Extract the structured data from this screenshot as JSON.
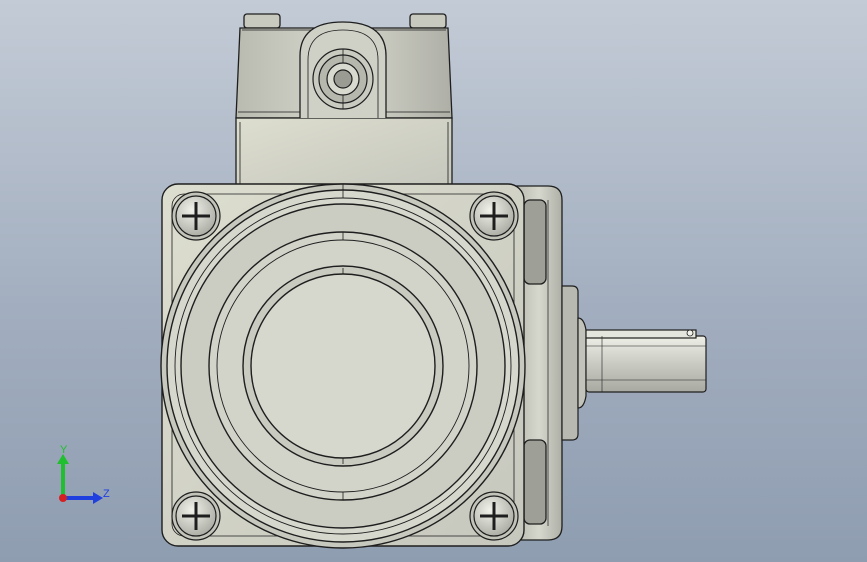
{
  "viewport": {
    "background_top": "#c3cbd6",
    "background_bottom": "#8f9db1",
    "model_fill": "#d3d4cb",
    "model_shade": "#b8b9b0",
    "model_edge": "#1e1e1e"
  },
  "triad": {
    "y_label": "Y",
    "z_label": "Z",
    "y_color": "#1fbf2f",
    "z_color": "#1f3fdf",
    "x_color": "#d42020"
  },
  "model": {
    "screws": [
      "screw-top-left",
      "screw-top-right",
      "screw-bottom-left",
      "screw-bottom-right"
    ],
    "icon": "hydraulic-vane-pump"
  }
}
